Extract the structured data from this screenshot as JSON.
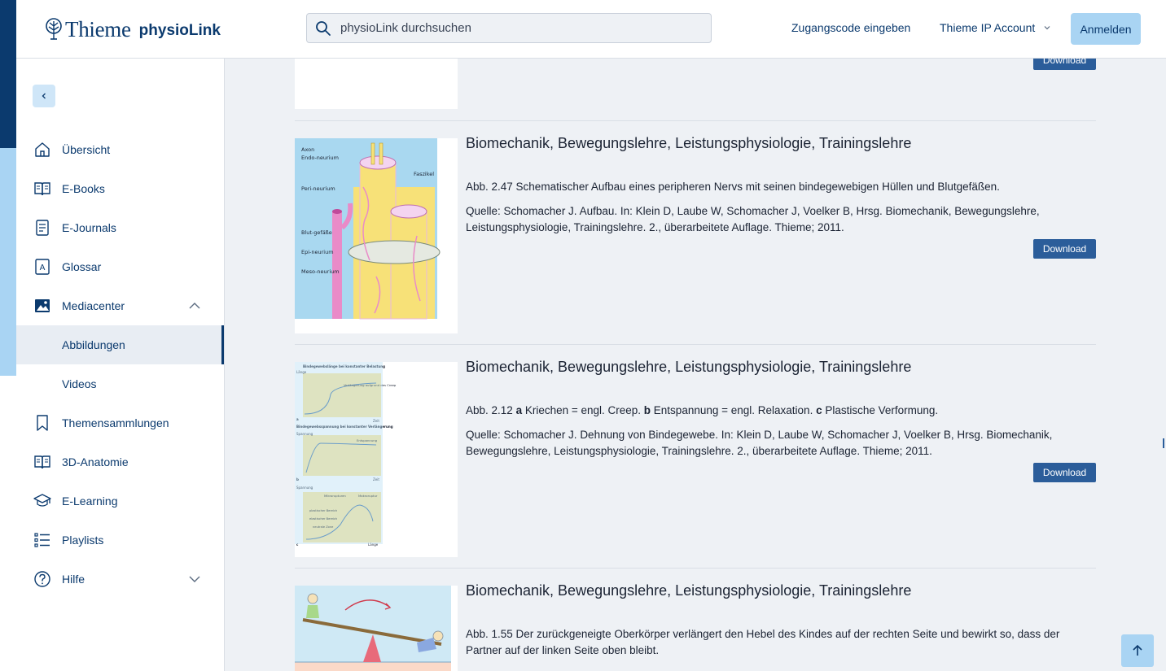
{
  "header": {
    "logo_text": "Thieme",
    "logo_product": "physioLink",
    "search_placeholder": "physioLink durchsuchen",
    "access_code": "Zugangscode eingeben",
    "ip_account": "Thieme IP Account",
    "login": "Anmelden"
  },
  "sidebar": {
    "items": [
      {
        "label": "Übersicht",
        "icon": "home-icon"
      },
      {
        "label": "E-Books",
        "icon": "book-icon"
      },
      {
        "label": "E-Journals",
        "icon": "document-icon"
      },
      {
        "label": "Glossar",
        "icon": "glossary-icon"
      },
      {
        "label": "Mediacenter",
        "icon": "image-icon",
        "expanded": true
      },
      {
        "label": "Abbildungen",
        "active": true
      },
      {
        "label": "Videos"
      },
      {
        "label": "Themensammlungen",
        "icon": "bookmark-icon"
      },
      {
        "label": "3D-Anatomie",
        "icon": "book-icon"
      },
      {
        "label": "E-Learning",
        "icon": "graduation-cap-icon"
      },
      {
        "label": "Playlists",
        "icon": "list-icon"
      },
      {
        "label": "Hilfe",
        "icon": "help-icon",
        "expanded": false
      }
    ]
  },
  "results": [
    {
      "download": "Download"
    },
    {
      "title": "Biomechanik, Bewegungslehre, Leistungsphysiologie, Trainingslehre",
      "caption": "Abb. 2.47 Schematischer Aufbau eines peripheren Nervs mit seinen bindegewebigen Hüllen und Blutgefäßen.",
      "source": "Quelle: Schomacher J. Aufbau. In: Klein D, Laube W, Schomacher J, Voelker B, Hrsg. Biomechanik, Bewegungslehre, Leistungsphysiologie, Trainingslehre. 2., überarbeitete Auflage. Thieme; 2011.",
      "download": "Download",
      "figure_labels": [
        "Axon",
        "Endo-neurium",
        "Faszikel",
        "Peri-neurium",
        "Blut-gefäße",
        "Epi-neurium",
        "Meso-neurium"
      ]
    },
    {
      "title": "Biomechanik, Bewegungslehre, Leistungsphysiologie, Trainingslehre",
      "caption_prefix": "Abb. 2.12 ",
      "caption_a": "a",
      "caption_a_text": " Kriechen = engl. Creep. ",
      "caption_b": "b",
      "caption_b_text": " Entspannung = engl. Relaxation. ",
      "caption_c": "c",
      "caption_c_text": " Plastische Verformung.",
      "source": "Quelle: Schomacher J. Dehnung von Bindegewebe. In: Klein D, Laube W, Schomacher J, Voelker B, Hrsg. Biomechanik, Bewegungslehre, Leistungsphysiologie, Trainingslehre. 2., überarbeitete Auflage. Thieme; 2011.",
      "download": "Download",
      "figure_labels": {
        "t1": "Bindegewebslänge bei konstanter Belastung",
        "t2": "Bindegewebsspannung bei konstanter Verlängerung",
        "l1": "Verlängerung aufgrund des Creep",
        "l2": "Entspannung",
        "l3": "Mikrorupturen",
        "l4": "Makroruptur",
        "l5": "plastischer Bereich",
        "l6": "elastischer Bereich",
        "l7": "neutrale Zone",
        "ax1": "Länge",
        "ax2": "Zeit",
        "ax3": "Spannung",
        "ax4": "Zeit",
        "ax5": "Spannung",
        "ax6": "Länge",
        "pa": "a",
        "pb": "b",
        "pc": "c"
      }
    },
    {
      "title": "Biomechanik, Bewegungslehre, Leistungsphysiologie, Trainingslehre",
      "caption": "Abb. 1.55 Der zurückgeneigte Oberkörper verlängert den Hebel des Kindes auf der rechten Seite und bewirkt so, dass der Partner auf der linken Seite oben bleibt."
    }
  ],
  "colors": {
    "brand": "#0b3a6e",
    "accent_light": "#a9d4f3",
    "download_button": "#2b5d9a"
  }
}
